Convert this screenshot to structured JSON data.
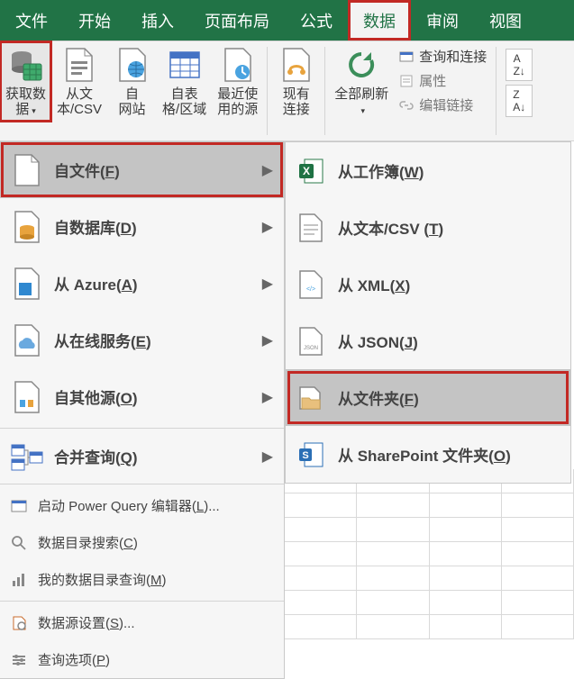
{
  "tabs": {
    "file": "文件",
    "home": "开始",
    "insert": "插入",
    "pagelayout": "页面布局",
    "formulas": "公式",
    "data": "数据",
    "review": "审阅",
    "view": "视图"
  },
  "ribbon": {
    "get_data": "获取数\n据",
    "from_text_csv": "从文\n本/CSV",
    "from_web": "自\n网站",
    "from_table": "自表\n格/区域",
    "recent": "最近使\n用的源",
    "existing_conn": "现有\n连接",
    "refresh_all": "全部刷新",
    "queries_conn": "查询和连接",
    "properties": "属性",
    "edit_links": "编辑链接"
  },
  "menu": {
    "from_file": "自文件(F)",
    "from_db": "自数据库(D)",
    "from_azure": "从 Azure(A)",
    "from_online": "从在线服务(E)",
    "from_other": "自其他源(O)",
    "combine": "合并查询(Q)",
    "launch_pq": "启动 Power Query 编辑器(L)...",
    "catalog_search": "数据目录搜索(C)",
    "my_catalog": "我的数据目录查询(M)",
    "ds_settings": "数据源设置(S)...",
    "query_options": "查询选项(P)"
  },
  "submenu": {
    "from_workbook": "从工作簿(W)",
    "from_text_csv": "从文本/CSV (T)",
    "from_xml": "从 XML(X)",
    "from_json": "从 JSON(J)",
    "from_folder": "从文件夹(F)",
    "from_sharepoint": "从 SharePoint 文件夹(O)"
  }
}
